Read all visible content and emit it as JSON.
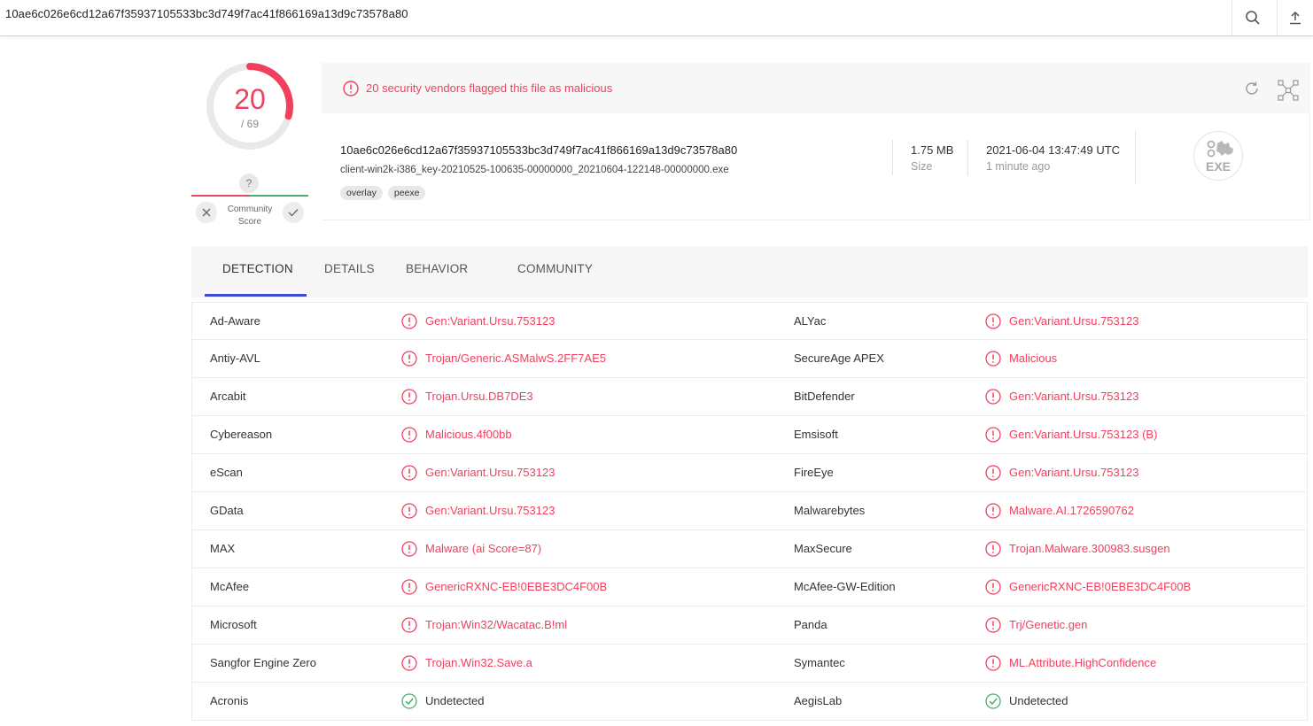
{
  "search": {
    "query": "10ae6c026e6cd12a67f35937105533bc3d749f7ac41f866169a13d9c73578a80"
  },
  "score": {
    "detections": "20",
    "total": "/ 69",
    "ratio": 0.29
  },
  "community": {
    "question": "?",
    "label_line1": "Community",
    "label_line2": "Score"
  },
  "alert": {
    "text": "20 security vendors flagged this file as malicious"
  },
  "file": {
    "hash": "10ae6c026e6cd12a67f35937105533bc3d749f7ac41f866169a13d9c73578a80",
    "name": "client-win2k-i386_key-20210525-100635-00000000_20210604-122148-00000000.exe",
    "tags": [
      "overlay",
      "peexe"
    ],
    "size_value": "1.75 MB",
    "size_label": "Size",
    "date_value": "2021-06-04 13:47:49 UTC",
    "date_label": "1 minute ago",
    "type_badge": "EXE"
  },
  "tabs": [
    "DETECTION",
    "DETAILS",
    "BEHAVIOR",
    "COMMUNITY"
  ],
  "colors": {
    "malicious": "#f0405e",
    "clean": "#4cae73",
    "tab_accent": "#3b4bd8"
  },
  "detections": [
    {
      "v1": "Ad-Aware",
      "r1": "Gen:Variant.Ursu.753123",
      "s1": "malicious",
      "v2": "ALYac",
      "r2": "Gen:Variant.Ursu.753123",
      "s2": "malicious"
    },
    {
      "v1": "Antiy-AVL",
      "r1": "Trojan/Generic.ASMalwS.2FF7AE5",
      "s1": "malicious",
      "v2": "SecureAge APEX",
      "r2": "Malicious",
      "s2": "malicious"
    },
    {
      "v1": "Arcabit",
      "r1": "Trojan.Ursu.DB7DE3",
      "s1": "malicious",
      "v2": "BitDefender",
      "r2": "Gen:Variant.Ursu.753123",
      "s2": "malicious"
    },
    {
      "v1": "Cybereason",
      "r1": "Malicious.4f00bb",
      "s1": "malicious",
      "v2": "Emsisoft",
      "r2": "Gen:Variant.Ursu.753123 (B)",
      "s2": "malicious"
    },
    {
      "v1": "eScan",
      "r1": "Gen:Variant.Ursu.753123",
      "s1": "malicious",
      "v2": "FireEye",
      "r2": "Gen:Variant.Ursu.753123",
      "s2": "malicious"
    },
    {
      "v1": "GData",
      "r1": "Gen:Variant.Ursu.753123",
      "s1": "malicious",
      "v2": "Malwarebytes",
      "r2": "Malware.AI.1726590762",
      "s2": "malicious"
    },
    {
      "v1": "MAX",
      "r1": "Malware (ai Score=87)",
      "s1": "malicious",
      "v2": "MaxSecure",
      "r2": "Trojan.Malware.300983.susgen",
      "s2": "malicious"
    },
    {
      "v1": "McAfee",
      "r1": "GenericRXNC-EB!0EBE3DC4F00B",
      "s1": "malicious",
      "v2": "McAfee-GW-Edition",
      "r2": "GenericRXNC-EB!0EBE3DC4F00B",
      "s2": "malicious"
    },
    {
      "v1": "Microsoft",
      "r1": "Trojan:Win32/Wacatac.B!ml",
      "s1": "malicious",
      "v2": "Panda",
      "r2": "Trj/Genetic.gen",
      "s2": "malicious"
    },
    {
      "v1": "Sangfor Engine Zero",
      "r1": "Trojan.Win32.Save.a",
      "s1": "malicious",
      "v2": "Symantec",
      "r2": "ML.Attribute.HighConfidence",
      "s2": "malicious"
    },
    {
      "v1": "Acronis",
      "r1": "Undetected",
      "s1": "clean",
      "v2": "AegisLab",
      "r2": "Undetected",
      "s2": "clean"
    }
  ]
}
